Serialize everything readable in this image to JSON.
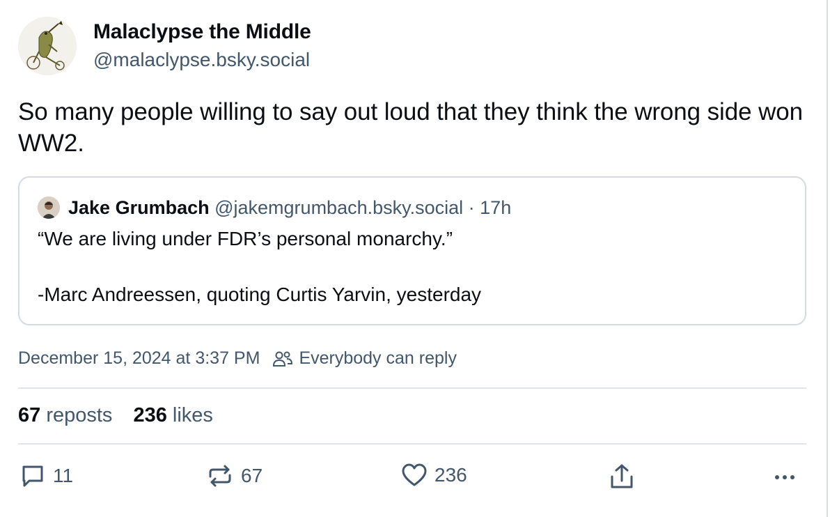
{
  "author": {
    "display_name": "Malaclypse the Middle",
    "handle": "@malaclypse.bsky.social",
    "avatar_icon": "frog-on-bicycle-avatar"
  },
  "post": {
    "text": "So many people willing to say out loud that they think the wrong side won WW2."
  },
  "quoted_post": {
    "display_name": "Jake Grumbach",
    "handle": "@jakemgrumbach.bsky.social",
    "separator": " · ",
    "time": "17h",
    "line1": "“We are living under FDR’s personal monarchy.”",
    "line2": "-Marc Andreessen, quoting Curtis Yarvin, yesterday"
  },
  "meta": {
    "timestamp": "December 15, 2024 at 3:37 PM",
    "reply_setting_icon": "people-icon",
    "reply_setting": "Everybody can reply"
  },
  "stats": {
    "reposts_count": "67",
    "reposts_label": "reposts",
    "likes_count": "236",
    "likes_label": "likes"
  },
  "actions": {
    "reply_count": "11",
    "repost_count": "67",
    "like_count": "236"
  },
  "colors": {
    "text": "#0b0f14",
    "muted": "#42576c",
    "border": "#d4dbe2"
  }
}
